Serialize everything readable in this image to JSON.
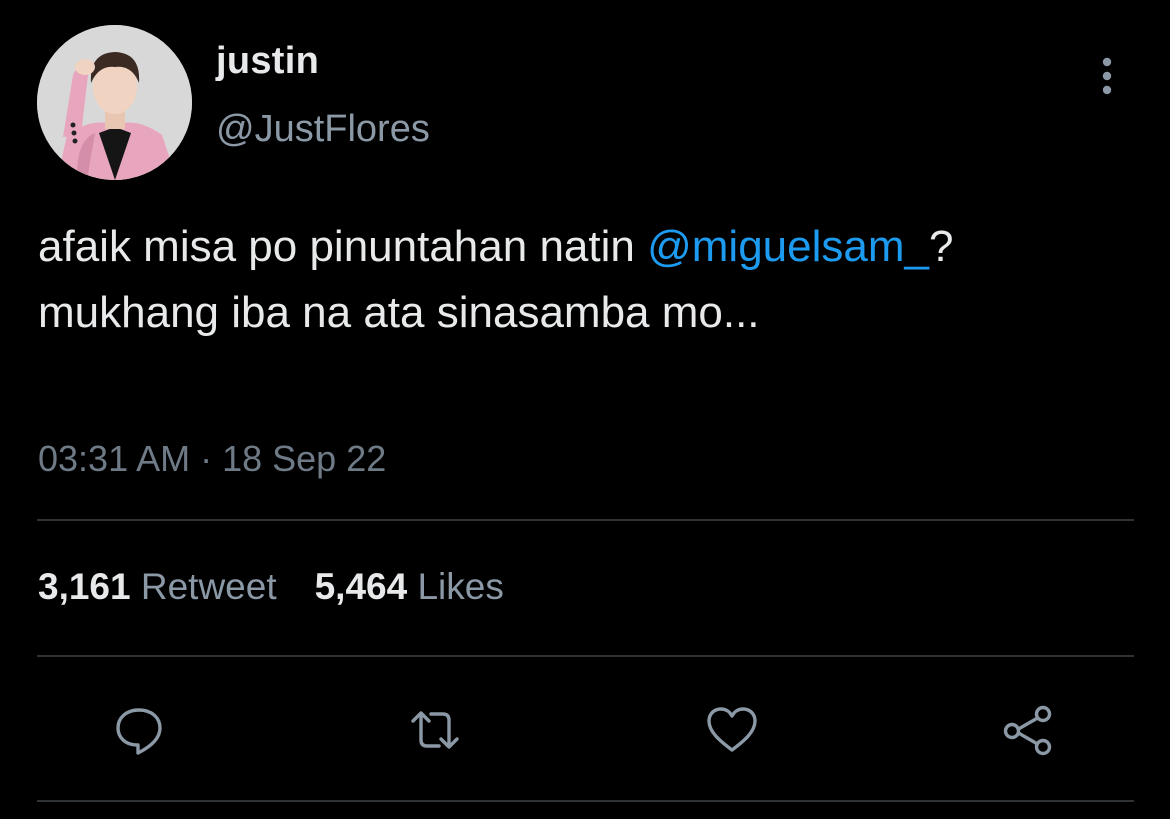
{
  "user": {
    "display_name": "justin",
    "handle": "@JustFlores",
    "avatar": "profile-photo"
  },
  "tweet": {
    "text_before": "afaik misa po pinuntahan natin ",
    "mention": "@miguelsam_",
    "text_after": "? mukhang iba na ata sinasamba mo...",
    "timestamp": "03:31 AM · 18 Sep 22"
  },
  "stats": {
    "retweets_count": "3,161",
    "retweets_label": "Retweet",
    "likes_count": "5,464",
    "likes_label": "Likes"
  },
  "actions": [
    {
      "name": "reply",
      "icon": "speech-bubble-icon"
    },
    {
      "name": "retweet",
      "icon": "retweet-arrows-icon"
    },
    {
      "name": "like",
      "icon": "heart-icon"
    },
    {
      "name": "share",
      "icon": "share-nodes-icon"
    }
  ],
  "colors": {
    "background": "#000000",
    "text": "#e7e9ea",
    "secondary": "#8b98a5",
    "link": "#1d9bf0",
    "divider": "#2f3336"
  }
}
